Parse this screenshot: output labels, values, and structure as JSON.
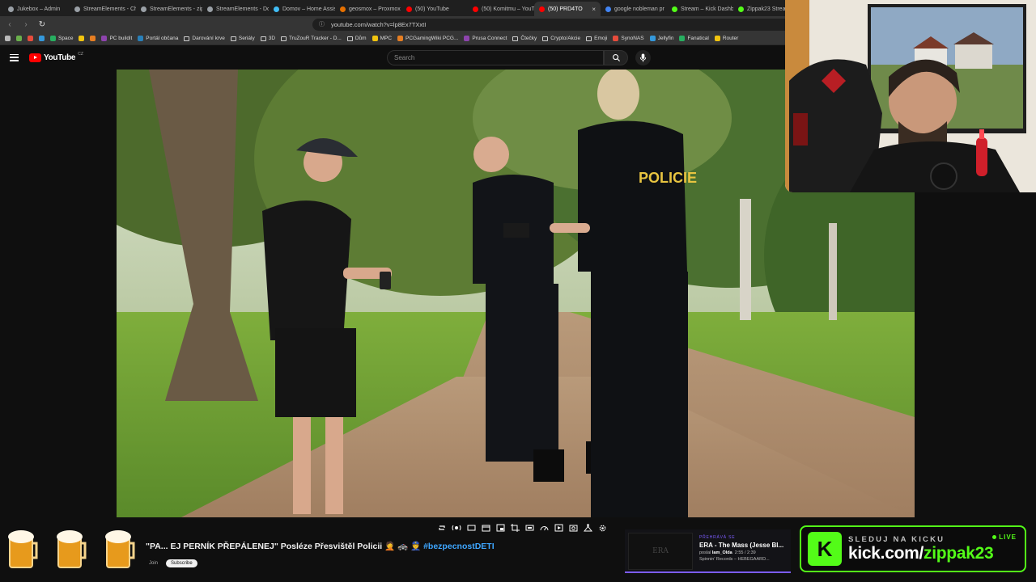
{
  "browser": {
    "tabs": [
      {
        "title": "Jukebox – Admin",
        "color": "#9aa0a6"
      },
      {
        "title": "StreamElements - Ch",
        "color": "#9aa0a6"
      },
      {
        "title": "StreamElements - zip",
        "color": "#9aa0a6"
      },
      {
        "title": "StreamElements - Do",
        "color": "#9aa0a6"
      },
      {
        "title": "Domov – Home Assis",
        "color": "#41bdf5"
      },
      {
        "title": "geosmox – Proxmox V",
        "color": "#e57000"
      },
      {
        "title": "(50) YouTube",
        "color": "#ff0000"
      },
      {
        "title": "(50) Komitmu – YouTu",
        "color": "#ff0000"
      },
      {
        "title": "(50) PRD4TO",
        "color": "#ff0000",
        "active": true
      },
      {
        "title": "google nobleman pr",
        "color": "#4285f4"
      },
      {
        "title": "Stream – Kick Dashb",
        "color": "#53fc18"
      },
      {
        "title": "Zippak23 Stream",
        "color": "#53fc18"
      }
    ],
    "url": "youtube.com/watch?v=lp8Ex7TXxtI",
    "bookmarks": [
      {
        "label": "",
        "type": "icon"
      },
      {
        "label": "",
        "type": "icon"
      },
      {
        "label": "",
        "type": "icon"
      },
      {
        "label": "",
        "type": "icon"
      },
      {
        "label": "Space",
        "type": "icon"
      },
      {
        "label": "",
        "type": "icon"
      },
      {
        "label": "",
        "type": "icon"
      },
      {
        "label": "PC buildit",
        "type": "icon"
      },
      {
        "label": "Portál občana",
        "type": "icon"
      },
      {
        "label": "Darování krve",
        "type": "folder"
      },
      {
        "label": "Seriály",
        "type": "folder"
      },
      {
        "label": "3D",
        "type": "folder"
      },
      {
        "label": "TruZouR Tracker - D...",
        "type": "folder"
      },
      {
        "label": "Dům",
        "type": "folder"
      },
      {
        "label": "MPC",
        "type": "icon"
      },
      {
        "label": "PCGamingWiki PCG...",
        "type": "icon"
      },
      {
        "label": "Prusa Connect",
        "type": "icon"
      },
      {
        "label": "Čtečky",
        "type": "folder"
      },
      {
        "label": "Crypto/Akcie",
        "type": "folder"
      },
      {
        "label": "Emoji",
        "type": "folder"
      },
      {
        "label": "SynoNAS",
        "type": "icon"
      },
      {
        "label": "Jellyfin",
        "type": "icon"
      },
      {
        "label": "Fanatical",
        "type": "icon"
      },
      {
        "label": "Router",
        "type": "icon"
      }
    ]
  },
  "youtube": {
    "logo_text": "YouTube",
    "logo_country": "CZ",
    "search_placeholder": "Search",
    "video_title_prefix": "\"PA... EJ PERNÍK PŘEPÁLENEJ\" Posléze Přesvištěl Policii 🤦 🚓 👮 ",
    "video_title_tag": "#bezpecnostDETI",
    "join_label": "Join",
    "subscribe_label": "Subscribe"
  },
  "video_scene": {
    "police_label": "POLICIE"
  },
  "now_playing": {
    "label": "PŘEHRÁVÁ SE",
    "song": "ERA - The Mass (Jesse Bl...",
    "requested_by_prefix": "poslal",
    "requested_by": "Iam_Olda",
    "time": "2:55 / 2:39",
    "label_line": "Spinnin' Records – HEBEGAARD...",
    "art_text": "ERA"
  },
  "kick": {
    "top": "SLEDUJ NA KICKU",
    "url_prefix": "kick.com/",
    "url_channel": "zippak23",
    "live": "LIVE",
    "letter": "K"
  },
  "colors": {
    "kick_green": "#53fc18",
    "yt_red": "#ff0000",
    "link_blue": "#3ea6ff"
  }
}
